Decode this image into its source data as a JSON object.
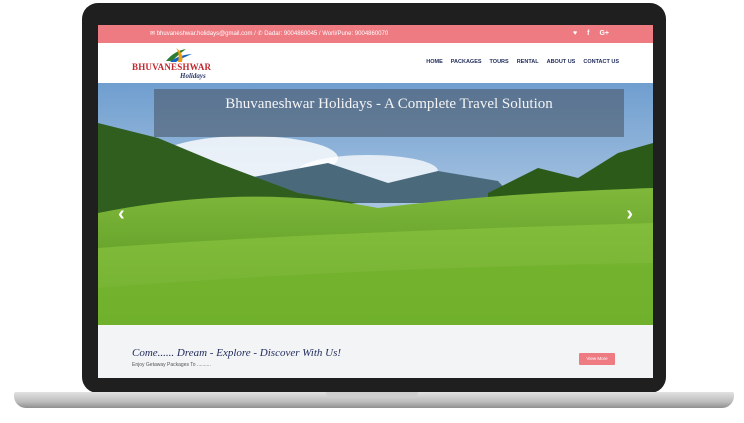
{
  "topbar": {
    "contact": "✉ bhuvaneshwar.holidays@gmail.com / ✆ Dadar: 9004860045 / Worli/Pune: 9004860070",
    "social": [
      "♥",
      "f",
      "G+"
    ]
  },
  "logo": {
    "name": "BHUVANESHWAR",
    "sub": "Holidays"
  },
  "nav": [
    "HOME",
    "PACKAGES",
    "TOURS",
    "RENTAL",
    "ABOUT US",
    "CONTACT US"
  ],
  "hero": {
    "title": "Bhuvaneshwar Holidays - A Complete Travel Solution",
    "prev": "‹",
    "next": "›"
  },
  "footer": {
    "headline": "Come...... Dream - Explore - Discover With Us!",
    "tagline": "Enjoy Getaway Packages To ..........",
    "button": "View More"
  },
  "colors": {
    "accent": "#ee7a82",
    "navy": "#1f2a5a",
    "brand_red": "#c1272d"
  }
}
